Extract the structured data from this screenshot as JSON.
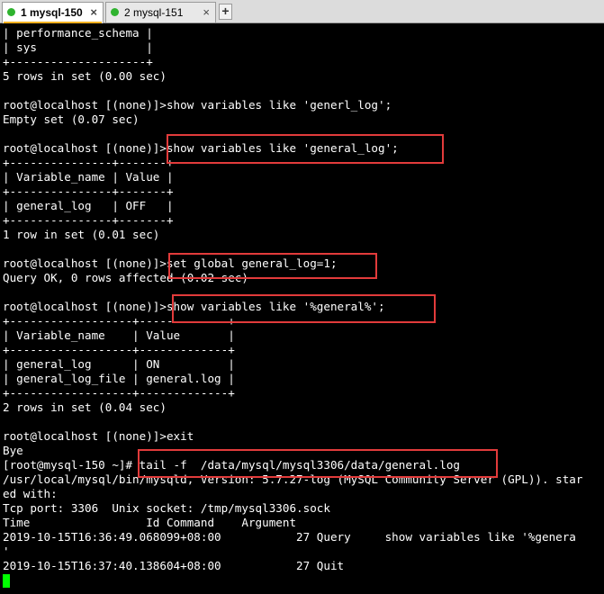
{
  "tabs": [
    {
      "label": "1 mysql-150",
      "close": "×"
    },
    {
      "label": "2 mysql-151",
      "close": "×"
    }
  ],
  "new_tab": "+",
  "terminal_lines": [
    "| performance_schema |",
    "| sys                |",
    "+--------------------+",
    "5 rows in set (0.00 sec)",
    "",
    "root@localhost [(none)]>show variables like 'generl_log';",
    "Empty set (0.07 sec)",
    "",
    "root@localhost [(none)]>show variables like 'general_log';",
    "+---------------+-------+",
    "| Variable_name | Value |",
    "+---------------+-------+",
    "| general_log   | OFF   |",
    "+---------------+-------+",
    "1 row in set (0.01 sec)",
    "",
    "root@localhost [(none)]>set global general_log=1;",
    "Query OK, 0 rows affected (0.02 sec)",
    "",
    "root@localhost [(none)]>show variables like '%general%';",
    "+------------------+-------------+",
    "| Variable_name    | Value       |",
    "+------------------+-------------+",
    "| general_log      | ON          |",
    "| general_log_file | general.log |",
    "+------------------+-------------+",
    "2 rows in set (0.04 sec)",
    "",
    "root@localhost [(none)]>exit",
    "Bye",
    "[root@mysql-150 ~]# tail -f  /data/mysql/mysql3306/data/general.log",
    "/usr/local/mysql/bin/mysqld, Version: 5.7.27-log (MySQL Community Server (GPL)). star",
    "ed with:",
    "Tcp port: 3306  Unix socket: /tmp/mysql3306.sock",
    "Time                 Id Command    Argument",
    "2019-10-15T16:36:49.068099+08:00           27 Query     show variables like '%genera",
    "'",
    "2019-10-15T16:37:40.138604+08:00           27 Quit"
  ]
}
